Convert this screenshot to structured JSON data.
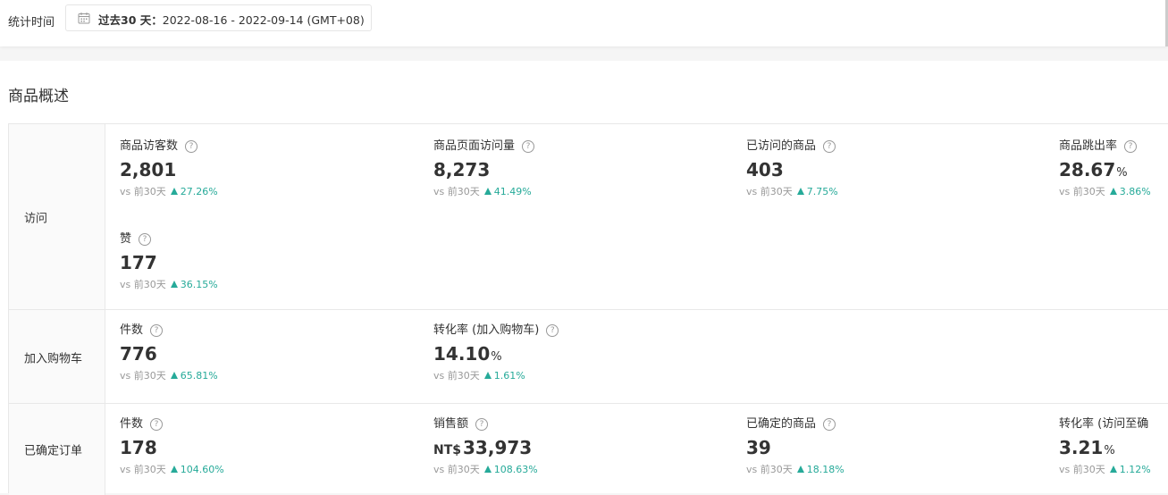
{
  "header": {
    "stat_label": "统计时间",
    "date_range_prefix": "过去30 天：",
    "date_range": "2022-08-16 - 2022-09-14 (GMT+08)",
    "calendar_icon": "calendar-icon"
  },
  "panel": {
    "title": "商品概述"
  },
  "help_icon": "?",
  "compare_prefix": "vs 前30天",
  "rows": {
    "visit": {
      "label": "访问",
      "metrics": [
        {
          "name": "商品访客数",
          "value": "2,801",
          "unit": "",
          "change": "27.26%"
        },
        {
          "name": "商品页面访问量",
          "value": "8,273",
          "unit": "",
          "change": "41.49%"
        },
        {
          "name": "已访问的商品",
          "value": "403",
          "unit": "",
          "change": "7.75%"
        },
        {
          "name": "商品跳出率",
          "value": "28.67",
          "unit": "%",
          "change": "3.86%"
        },
        {
          "name": "赞",
          "value": "177",
          "unit": "",
          "change": "36.15%"
        }
      ]
    },
    "cart": {
      "label": "加入购物车",
      "metrics": [
        {
          "name": "件数",
          "value": "776",
          "unit": "",
          "change": "65.81%"
        },
        {
          "name": "转化率 (加入购物车)",
          "value": "14.10",
          "unit": "%",
          "change": "1.61%"
        }
      ]
    },
    "order": {
      "label": "已确定订单",
      "metrics": [
        {
          "name": "件数",
          "value": "178",
          "unit": "",
          "change": "104.60%"
        },
        {
          "name": "销售额",
          "currency": "NT$",
          "value": "33,973",
          "unit": "",
          "change": "108.63%"
        },
        {
          "name": "已确定的商品",
          "value": "39",
          "unit": "",
          "change": "18.18%"
        },
        {
          "name": "转化率 (访问至确",
          "value": "3.21",
          "unit": "%",
          "change": "1.12%"
        }
      ]
    }
  },
  "colors": {
    "up": "#26aa99",
    "muted": "#999999",
    "text": "#333333"
  }
}
